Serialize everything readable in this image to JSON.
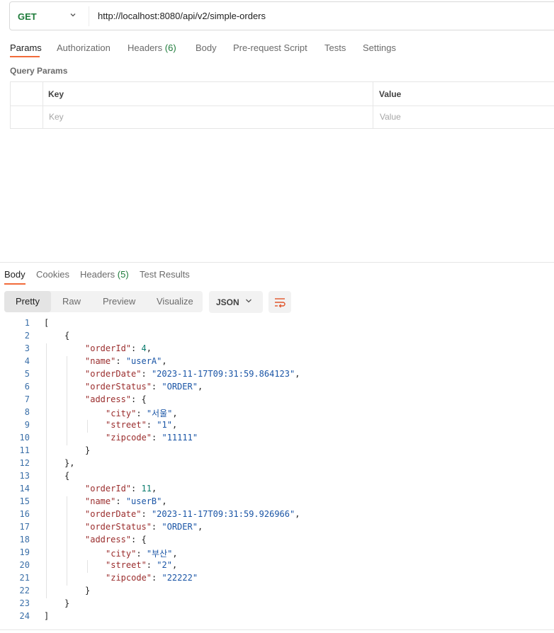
{
  "request": {
    "method": "GET",
    "url": "http://localhost:8080/api/v2/simple-orders"
  },
  "request_tabs": [
    {
      "label": "Params",
      "count": ""
    },
    {
      "label": "Authorization",
      "count": ""
    },
    {
      "label": "Headers",
      "count": "(6)"
    },
    {
      "label": "Body",
      "count": ""
    },
    {
      "label": "Pre-request Script",
      "count": ""
    },
    {
      "label": "Tests",
      "count": ""
    },
    {
      "label": "Settings",
      "count": ""
    }
  ],
  "query_params": {
    "title": "Query Params",
    "columns": [
      "Key",
      "Value"
    ],
    "placeholders": [
      "Key",
      "Value"
    ]
  },
  "response_tabs": [
    {
      "label": "Body",
      "count": ""
    },
    {
      "label": "Cookies",
      "count": ""
    },
    {
      "label": "Headers",
      "count": "(5)"
    },
    {
      "label": "Test Results",
      "count": ""
    }
  ],
  "view_modes": [
    "Pretty",
    "Raw",
    "Preview",
    "Visualize"
  ],
  "format": "JSON",
  "icons": {
    "method_dropdown": "chevron-down-icon",
    "format_dropdown": "chevron-down-icon",
    "wrap": "wrap-lines-icon"
  },
  "colors": {
    "accent": "#f26b3a",
    "get_method": "#1e7b3a"
  },
  "response_body": [
    {
      "ln": "1",
      "indent": 0,
      "tokens": [
        [
          "p",
          "["
        ]
      ]
    },
    {
      "ln": "2",
      "indent": 1,
      "tokens": [
        [
          "p",
          "{"
        ]
      ]
    },
    {
      "ln": "3",
      "indent": 2,
      "tokens": [
        [
          "k",
          "\"orderId\""
        ],
        [
          "p",
          ": "
        ],
        [
          "n",
          "4"
        ],
        [
          "p",
          ","
        ]
      ]
    },
    {
      "ln": "4",
      "indent": 2,
      "tokens": [
        [
          "k",
          "\"name\""
        ],
        [
          "p",
          ": "
        ],
        [
          "s",
          "\"userA\""
        ],
        [
          "p",
          ","
        ]
      ]
    },
    {
      "ln": "5",
      "indent": 2,
      "tokens": [
        [
          "k",
          "\"orderDate\""
        ],
        [
          "p",
          ": "
        ],
        [
          "s",
          "\"2023-11-17T09:31:59.864123\""
        ],
        [
          "p",
          ","
        ]
      ]
    },
    {
      "ln": "6",
      "indent": 2,
      "tokens": [
        [
          "k",
          "\"orderStatus\""
        ],
        [
          "p",
          ": "
        ],
        [
          "s",
          "\"ORDER\""
        ],
        [
          "p",
          ","
        ]
      ]
    },
    {
      "ln": "7",
      "indent": 2,
      "tokens": [
        [
          "k",
          "\"address\""
        ],
        [
          "p",
          ": {"
        ]
      ]
    },
    {
      "ln": "8",
      "indent": 3,
      "tokens": [
        [
          "k",
          "\"city\""
        ],
        [
          "p",
          ": "
        ],
        [
          "s",
          "\"서울\""
        ],
        [
          "p",
          ","
        ]
      ]
    },
    {
      "ln": "9",
      "indent": 3,
      "tokens": [
        [
          "k",
          "\"street\""
        ],
        [
          "p",
          ": "
        ],
        [
          "s",
          "\"1\""
        ],
        [
          "p",
          ","
        ]
      ]
    },
    {
      "ln": "10",
      "indent": 3,
      "tokens": [
        [
          "k",
          "\"zipcode\""
        ],
        [
          "p",
          ": "
        ],
        [
          "s",
          "\"11111\""
        ]
      ]
    },
    {
      "ln": "11",
      "indent": 2,
      "tokens": [
        [
          "p",
          "}"
        ]
      ]
    },
    {
      "ln": "12",
      "indent": 1,
      "tokens": [
        [
          "p",
          "},"
        ]
      ]
    },
    {
      "ln": "13",
      "indent": 1,
      "tokens": [
        [
          "p",
          "{"
        ]
      ]
    },
    {
      "ln": "14",
      "indent": 2,
      "tokens": [
        [
          "k",
          "\"orderId\""
        ],
        [
          "p",
          ": "
        ],
        [
          "n",
          "11"
        ],
        [
          "p",
          ","
        ]
      ]
    },
    {
      "ln": "15",
      "indent": 2,
      "tokens": [
        [
          "k",
          "\"name\""
        ],
        [
          "p",
          ": "
        ],
        [
          "s",
          "\"userB\""
        ],
        [
          "p",
          ","
        ]
      ]
    },
    {
      "ln": "16",
      "indent": 2,
      "tokens": [
        [
          "k",
          "\"orderDate\""
        ],
        [
          "p",
          ": "
        ],
        [
          "s",
          "\"2023-11-17T09:31:59.926966\""
        ],
        [
          "p",
          ","
        ]
      ]
    },
    {
      "ln": "17",
      "indent": 2,
      "tokens": [
        [
          "k",
          "\"orderStatus\""
        ],
        [
          "p",
          ": "
        ],
        [
          "s",
          "\"ORDER\""
        ],
        [
          "p",
          ","
        ]
      ]
    },
    {
      "ln": "18",
      "indent": 2,
      "tokens": [
        [
          "k",
          "\"address\""
        ],
        [
          "p",
          ": {"
        ]
      ]
    },
    {
      "ln": "19",
      "indent": 3,
      "tokens": [
        [
          "k",
          "\"city\""
        ],
        [
          "p",
          ": "
        ],
        [
          "s",
          "\"부산\""
        ],
        [
          "p",
          ","
        ]
      ]
    },
    {
      "ln": "20",
      "indent": 3,
      "tokens": [
        [
          "k",
          "\"street\""
        ],
        [
          "p",
          ": "
        ],
        [
          "s",
          "\"2\""
        ],
        [
          "p",
          ","
        ]
      ]
    },
    {
      "ln": "21",
      "indent": 3,
      "tokens": [
        [
          "k",
          "\"zipcode\""
        ],
        [
          "p",
          ": "
        ],
        [
          "s",
          "\"22222\""
        ]
      ]
    },
    {
      "ln": "22",
      "indent": 2,
      "tokens": [
        [
          "p",
          "}"
        ]
      ]
    },
    {
      "ln": "23",
      "indent": 1,
      "tokens": [
        [
          "p",
          "}"
        ]
      ]
    },
    {
      "ln": "24",
      "indent": 0,
      "tokens": [
        [
          "p",
          "]"
        ]
      ]
    }
  ]
}
